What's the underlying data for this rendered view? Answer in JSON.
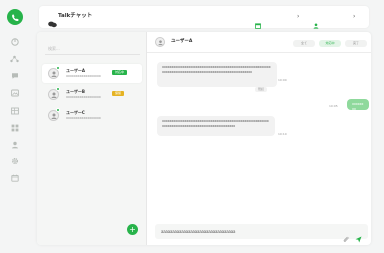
{
  "app": {
    "title": "Talkチャット",
    "accent": "#27b34a"
  },
  "sidebar": {
    "icons": [
      "dashboard-icon",
      "network-icon",
      "chat-icon",
      "image-icon",
      "table-icon",
      "grid-icon",
      "user-icon",
      "settings-icon",
      "calendar-icon"
    ]
  },
  "search": {
    "placeholder": "検索..."
  },
  "conversations": [
    {
      "name": "ユーザーA",
      "preview": "xxxxxxxxxxxxxxxxxx",
      "tag": "対応中",
      "tag_color": "#27b34a",
      "selected": true
    },
    {
      "name": "ユーザーB",
      "preview": "xxxxxxxxxxxxxxxxxx",
      "tag": "保留",
      "tag_color": "#e5b323",
      "selected": false
    },
    {
      "name": "ユーザーC",
      "preview": "xxxxxxxxxxxxxxxxxx",
      "tag": "",
      "tag_color": "",
      "selected": false
    }
  ],
  "chat": {
    "name": "ユーザーA",
    "filters": [
      "全て",
      "対応中",
      "完了"
    ],
    "active_filter": 1,
    "m1_text": "xxxxxxxxxxxxxxxxxxxxxxxxxxxxxxxxxxxxxxxxxxxxxxxxxxxxxxxxxxxxxxxxxxxxxxxxxxxxxxxxxxxxxxxxxxxxxxxxxxxxxxxxxx",
    "m1_time": "10:00",
    "m1_badge": "既読",
    "m2_text": "xxxxxxxx",
    "m2_time": "10:05",
    "m3_text": "xxxxxxxxxxxxxxxxxxxxxxxxxxxxxxxxxxxxxxxxxxxxxxxxxxxxxxxxxxxxxxxxxxxxxxxxxxxxxxxxxxxxxxxxxxxxxxxx",
    "m3_time": "10:10"
  },
  "composer": {
    "value": "aaaaaaaaaaaaaaaaaaaaaaaaaaaaaaaaa"
  }
}
